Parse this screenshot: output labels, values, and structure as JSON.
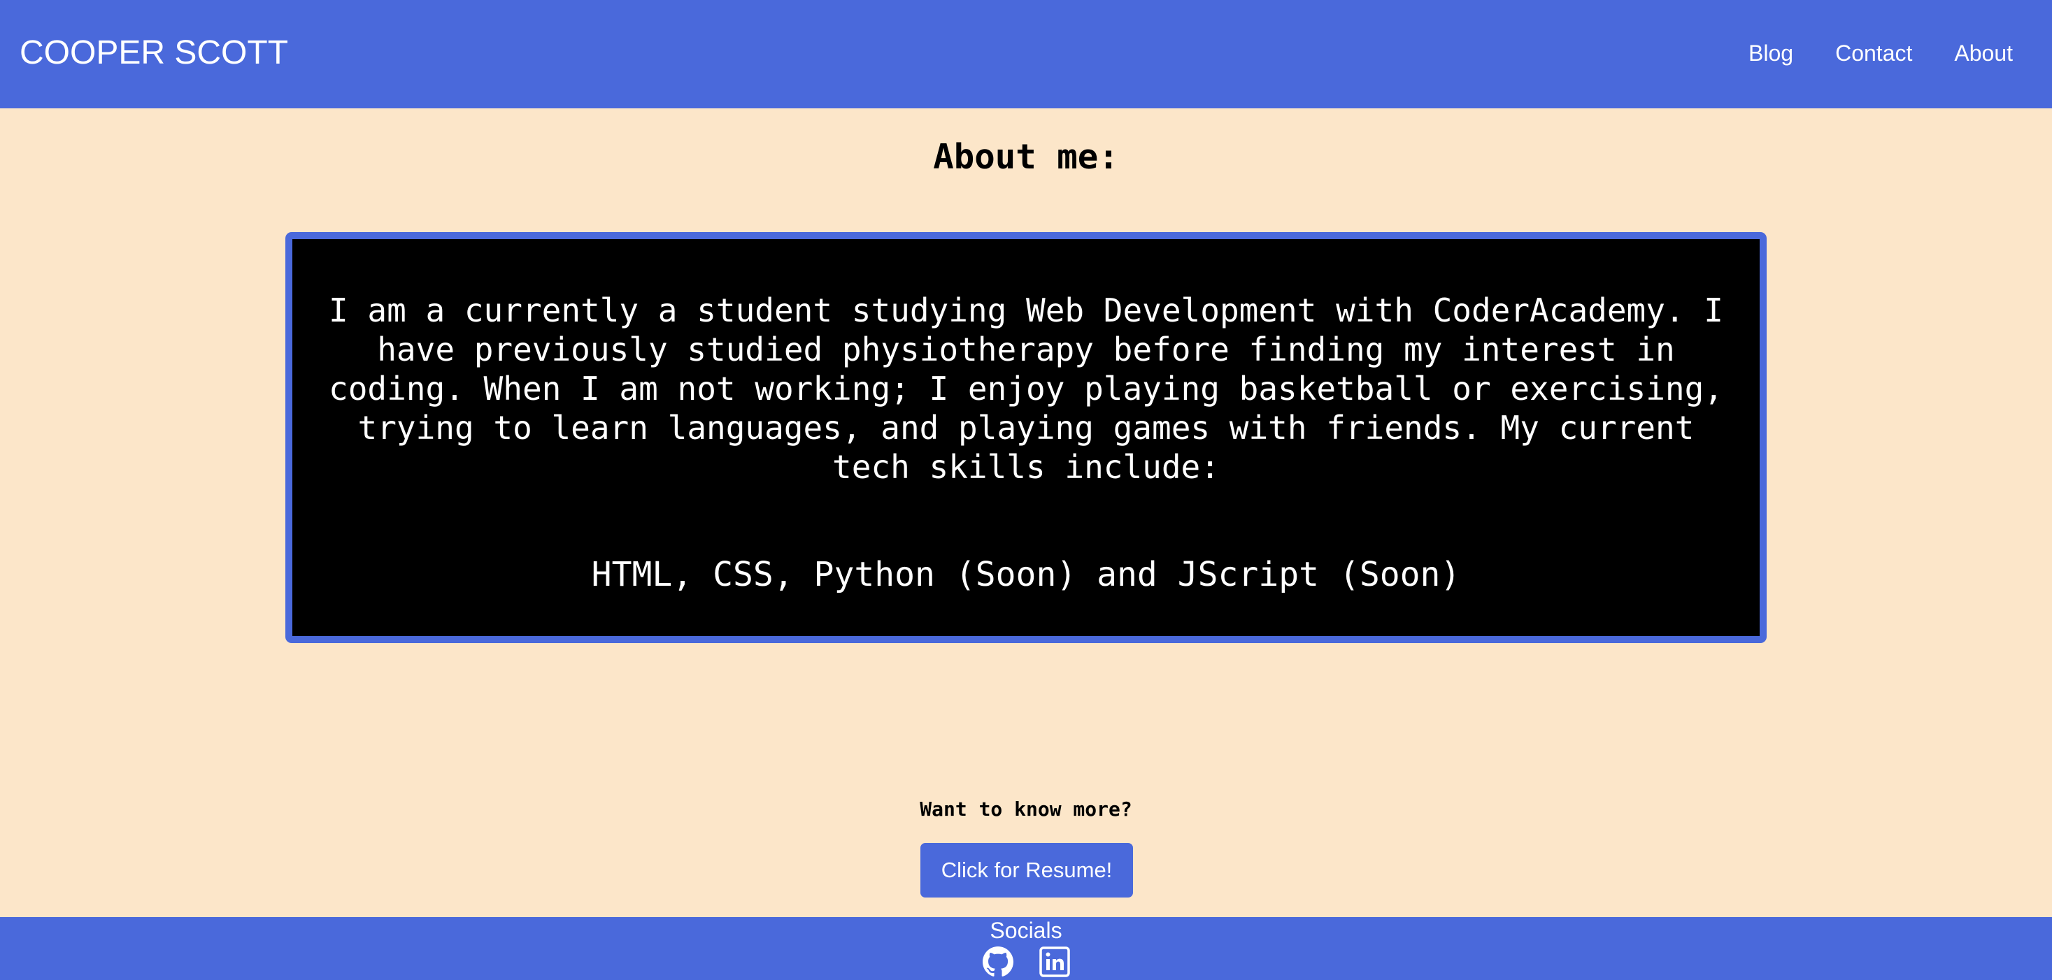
{
  "header": {
    "brand": "COOPER SCOTT",
    "nav": [
      {
        "label": "Blog"
      },
      {
        "label": "Contact"
      },
      {
        "label": "About"
      }
    ]
  },
  "main": {
    "title": "About me:",
    "about_text": "I am a currently a student studying Web Development with CoderAcademy. I have previously studied physiotherapy before finding my interest in coding. When I am not working; I enjoy playing basketball or exercising, trying to learn languages, and playing games with friends. My current tech skills include:",
    "skills": "HTML, CSS, Python (Soon) and JScript (Soon)",
    "more_label": "Want to know more?",
    "resume_button": "Click for Resume!"
  },
  "footer": {
    "socials_label": "Socials",
    "icons": [
      "github-icon",
      "linkedin-icon"
    ]
  },
  "colors": {
    "accent": "#4a69db",
    "background": "#fce6c9",
    "box_background": "#000000"
  }
}
